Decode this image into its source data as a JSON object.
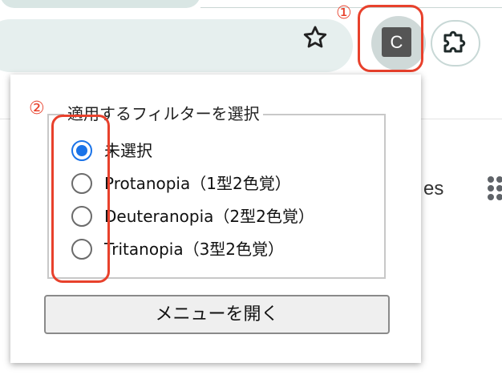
{
  "browser": {
    "annotation_1": "①",
    "extension_icon_letter": "C"
  },
  "page": {
    "partial_text": "es"
  },
  "popup": {
    "annotation_2": "②",
    "legend": "適用するフィルターを選択",
    "options": [
      {
        "label": "未選択",
        "checked": true
      },
      {
        "label": "Protanopia（1型2色覚）",
        "checked": false
      },
      {
        "label": "Deuteranopia（2型2色覚）",
        "checked": false
      },
      {
        "label": "Tritanopia（3型2色覚）",
        "checked": false
      }
    ],
    "menu_button_label": "メニューを開く"
  },
  "colors": {
    "annotation_red": "#e8412c",
    "radio_selected": "#1a73e8",
    "omnibox_bg": "#e6efee"
  }
}
